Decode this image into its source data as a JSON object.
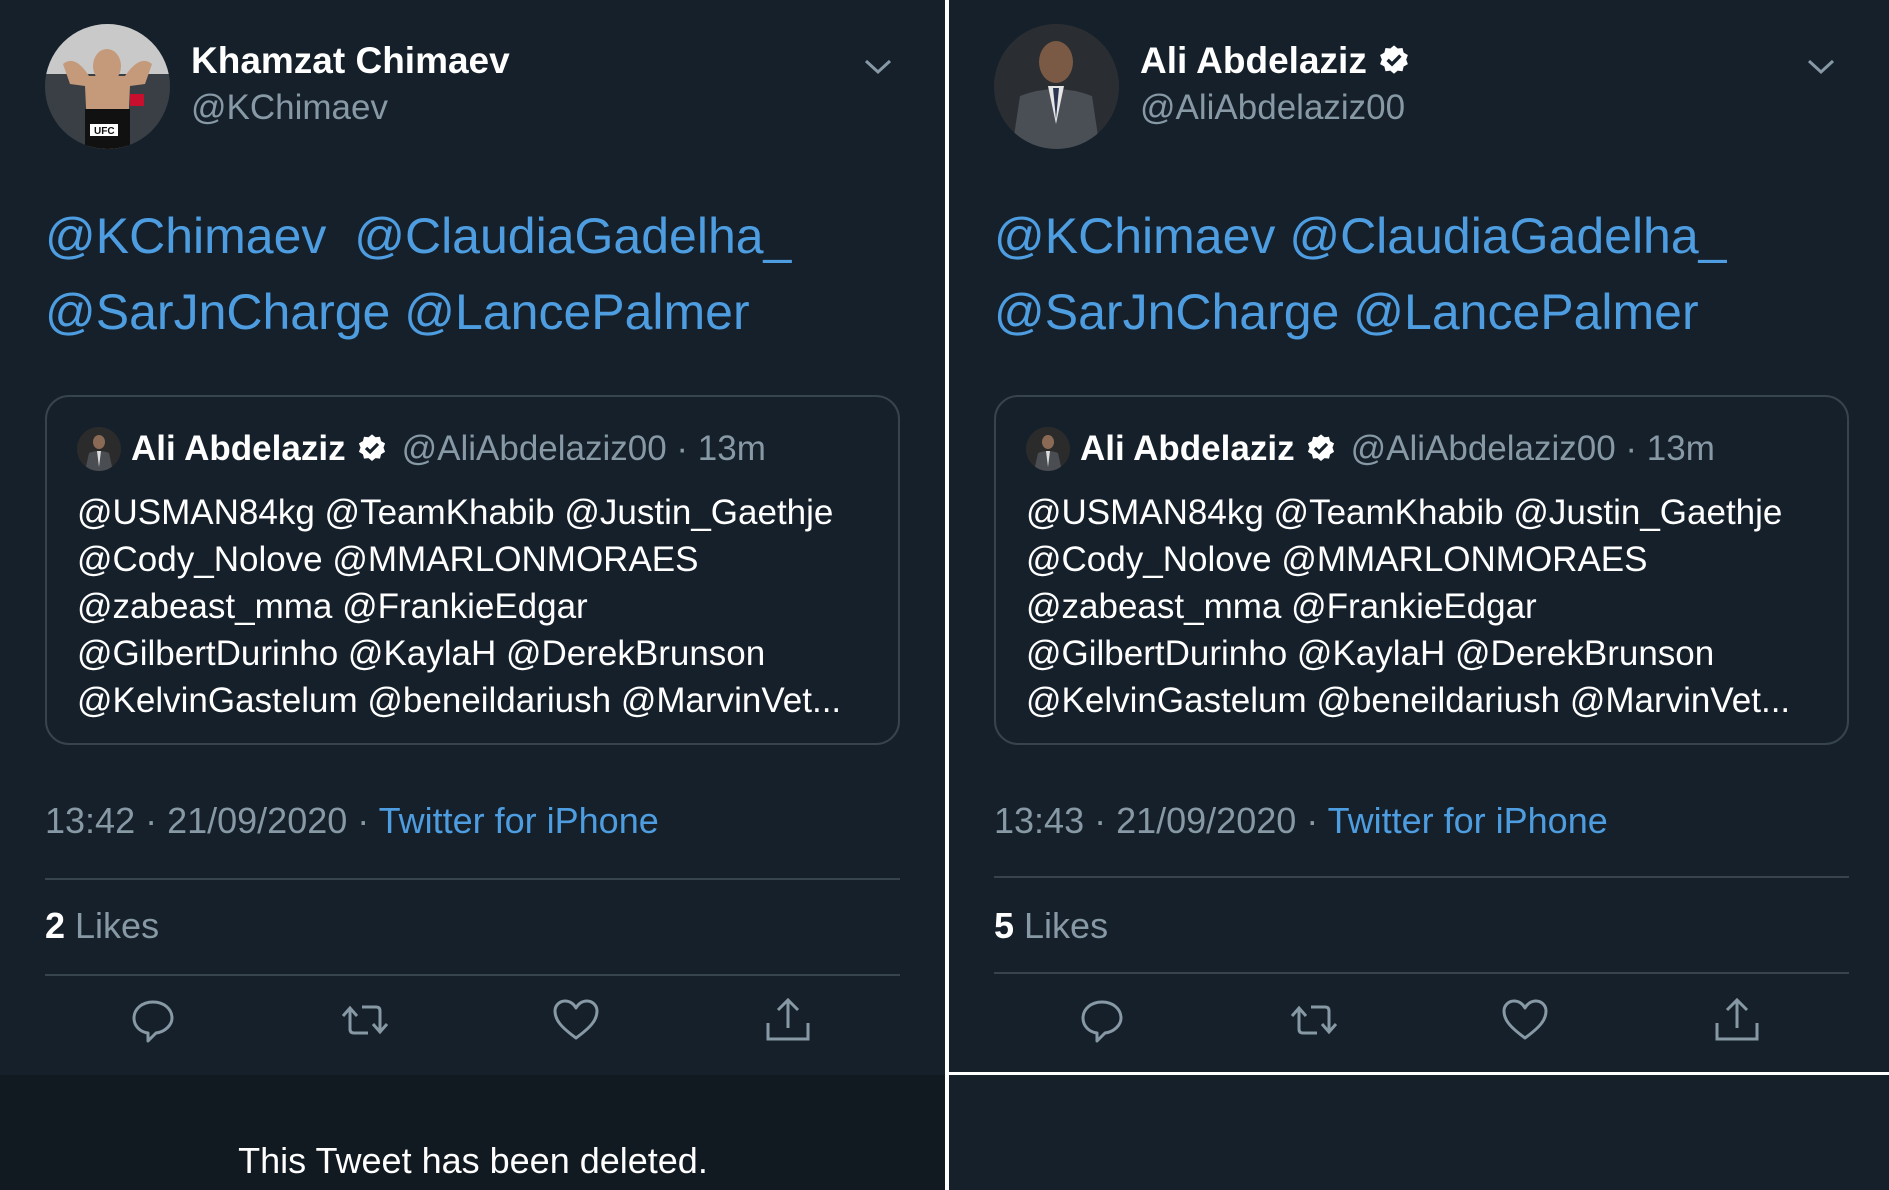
{
  "left": {
    "author": {
      "name": "Khamzat Chimaev",
      "handle": "@KChimaev",
      "verified": false
    },
    "mentions_line1": [
      "@KChimaev",
      "@ClaudiaGadelha_"
    ],
    "mentions_line2": [
      "@SarJnCharge",
      "@LancePalmer"
    ],
    "quote": {
      "name": "Ali Abdelaziz",
      "handle_time": "@AliAbdelaziz00 · 13m",
      "lines": [
        "@USMAN84kg @TeamKhabib @Justin_Gaethje",
        "@Cody_Nolove  @MMARLONMORAES",
        "@zabeast_mma @FrankieEdgar",
        "@GilbertDurinho @KaylaH @DerekBrunson",
        "@KelvinGastelum @beneildariush @MarvinVet..."
      ]
    },
    "time_date": "13:42 · 21/09/2020 · ",
    "source": "Twitter for iPhone",
    "likes_count": "2",
    "likes_label": " Likes",
    "deleted_notice": "This Tweet has been deleted."
  },
  "right": {
    "author": {
      "name": "Ali Abdelaziz",
      "handle": "@AliAbdelaziz00",
      "verified": true
    },
    "mentions_line1": [
      "@KChimaev",
      "@ClaudiaGadelha_"
    ],
    "mentions_line2": [
      "@SarJnCharge",
      "@LancePalmer"
    ],
    "quote": {
      "name": "Ali Abdelaziz",
      "handle_time": "@AliAbdelaziz00 · 13m",
      "lines": [
        "@USMAN84kg @TeamKhabib @Justin_Gaethje",
        "@Cody_Nolove  @MMARLONMORAES",
        "@zabeast_mma @FrankieEdgar",
        "@GilbertDurinho @KaylaH @DerekBrunson",
        "@KelvinGastelum @beneildariush @MarvinVet..."
      ]
    },
    "time_date": "13:43 · 21/09/2020 · ",
    "source": "Twitter for iPhone",
    "likes_count": "5",
    "likes_label": " Likes"
  },
  "icons": {
    "reply": "reply-icon",
    "retweet": "retweet-icon",
    "like": "heart-icon",
    "share": "share-icon",
    "menu": "chevron-down-icon",
    "verified": "verified-badge-icon"
  },
  "colors": {
    "background": "#15202b",
    "link": "#4d9de0",
    "secondary_text": "#8899a6",
    "border": "#38444d"
  }
}
